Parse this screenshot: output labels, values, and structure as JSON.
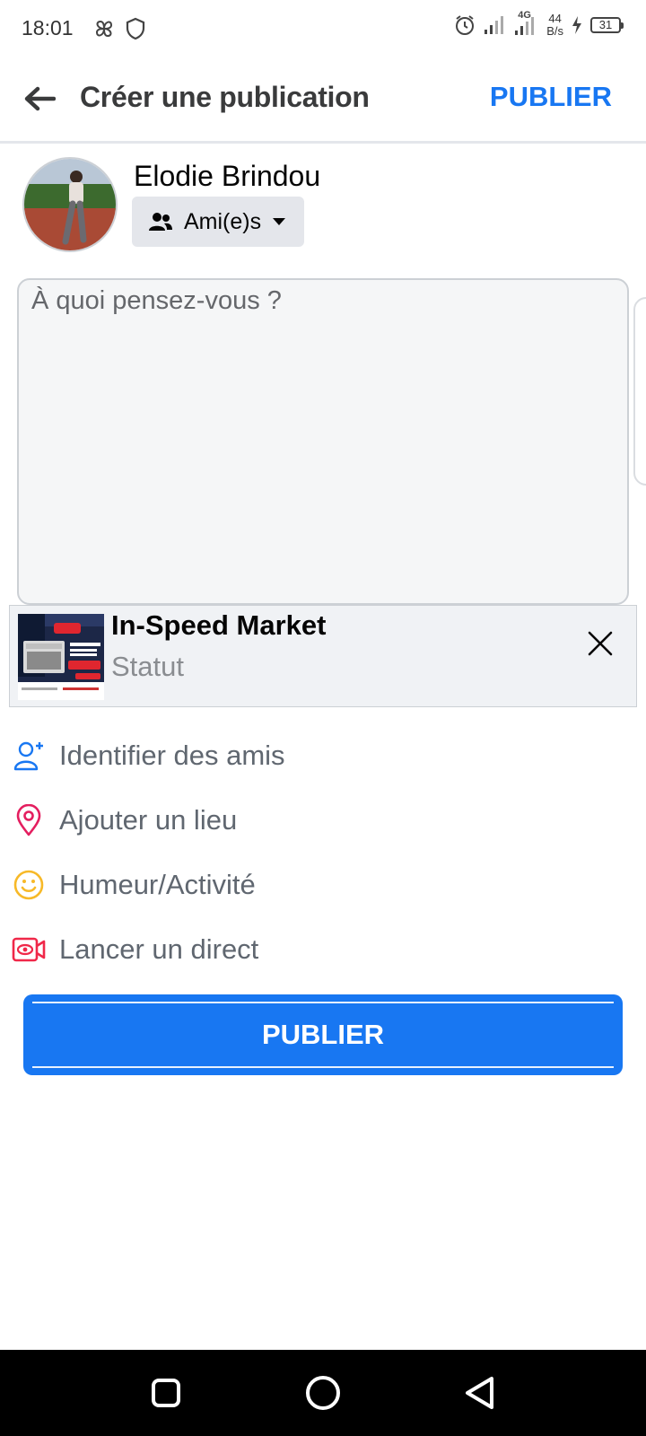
{
  "status_bar": {
    "time": "18:01",
    "network_label": "4G",
    "speed_value": "44",
    "speed_unit": "B/s",
    "battery": "31"
  },
  "header": {
    "title": "Créer une publication",
    "publish_label": "PUBLIER"
  },
  "author": {
    "name": "Elodie Brindou",
    "audience": "Ami(e)s"
  },
  "compose": {
    "placeholder": "À quoi pensez-vous ?"
  },
  "shared_card": {
    "title": "In-Speed Market",
    "subtitle": "Statut"
  },
  "options": [
    {
      "label": "Identifier des amis",
      "icon": "tag-friends-icon",
      "color": "#1877f2"
    },
    {
      "label": "Ajouter un lieu",
      "icon": "location-pin-icon",
      "color": "#e41e5f"
    },
    {
      "label": "Humeur/Activité",
      "icon": "smiley-icon",
      "color": "#f7b928"
    },
    {
      "label": "Lancer un direct",
      "icon": "live-video-icon",
      "color": "#f02849"
    }
  ],
  "publish_button": {
    "label": "PUBLIER"
  },
  "colors": {
    "accent": "#1877f2",
    "text_secondary": "#606770"
  }
}
